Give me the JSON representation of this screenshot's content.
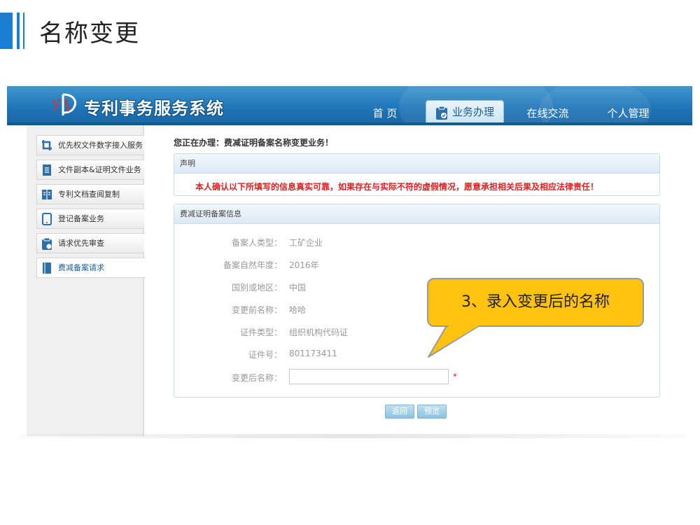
{
  "slide": {
    "title": "名称变更"
  },
  "header": {
    "logo_text": "专利事务服务系统",
    "nav": [
      {
        "label": "首 页"
      },
      {
        "label": "业务办理"
      },
      {
        "label": "在线交流"
      },
      {
        "label": "个人管理"
      }
    ]
  },
  "sidebar": {
    "items": [
      {
        "label": "优先权文件数字接入服务"
      },
      {
        "label": "文件副本&证明文件业务"
      },
      {
        "label": "专利文档查阅复制"
      },
      {
        "label": "登记备案业务"
      },
      {
        "label": "请求优先审查"
      },
      {
        "label": "费减备案请求"
      }
    ]
  },
  "main": {
    "doing": "您正在办理：费减证明备案名称变更业务！",
    "statement": {
      "title": "声明",
      "text": "本人确认以下所填写的信息真实可靠，如果存在与实际不符的虚假情况，愿意承担相关后果及相应法律责任！"
    },
    "info": {
      "title": "费减证明备案信息",
      "rows": [
        {
          "label": "备案人类型：",
          "value": "工矿企业"
        },
        {
          "label": "备案自然年度：",
          "value": "2016年"
        },
        {
          "label": "国别或地区：",
          "value": "中国"
        },
        {
          "label": "变更前名称：",
          "value": "哈哈"
        },
        {
          "label": "证件类型：",
          "value": "组织机构代码证"
        },
        {
          "label": "证件号：",
          "value": "801173411"
        }
      ],
      "new_name_label": "变更后名称：",
      "new_name_value": "",
      "required_mark": "*"
    },
    "buttons": {
      "back": "返回",
      "preview": "预览"
    }
  },
  "callout": {
    "text": "3、录入变更后的名称"
  },
  "colors": {
    "accent": "#1b7fd1",
    "header": "#1d73b6",
    "warning": "#e02020",
    "callout": "#ffc20e"
  }
}
